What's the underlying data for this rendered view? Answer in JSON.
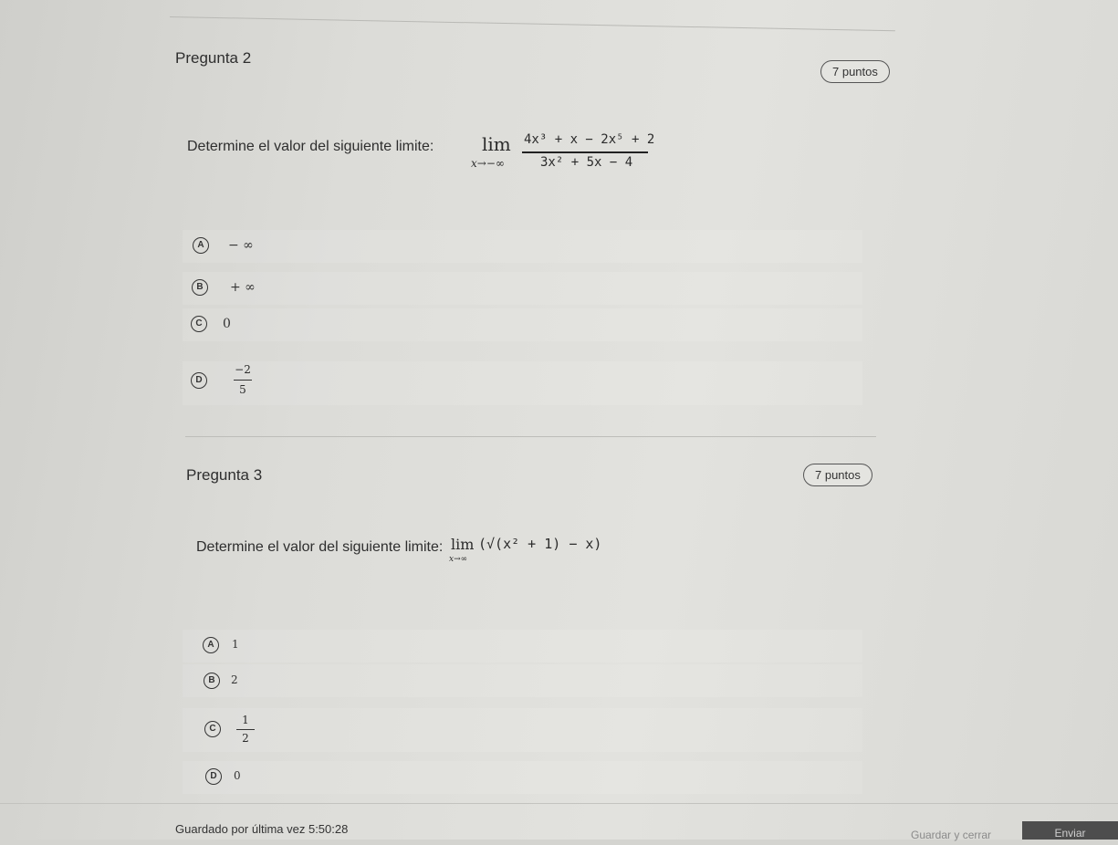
{
  "questions": [
    {
      "title": "Pregunta 2",
      "points": "7 puntos",
      "prompt": "Determine el valor del siguiente limite:",
      "limit": {
        "word": "lim",
        "sub": "x→−∞",
        "numerator": "4x³ + x − 2x⁵ + 2",
        "denominator": "3x² + 5x − 4"
      },
      "options": [
        {
          "letter": "A",
          "text": "− ∞"
        },
        {
          "letter": "B",
          "text": "+ ∞"
        },
        {
          "letter": "C",
          "text": "0"
        },
        {
          "letter": "D",
          "num": "−2",
          "den": "5"
        }
      ]
    },
    {
      "title": "Pregunta 3",
      "points": "7 puntos",
      "prompt": "Determine el valor del siguiente limite:",
      "limit": {
        "word": "lim",
        "sub": "x→∞",
        "expression": "(√(x² + 1) − x)"
      },
      "options": [
        {
          "letter": "A",
          "text": "1"
        },
        {
          "letter": "B",
          "text": "2"
        },
        {
          "letter": "C",
          "num": "1",
          "den": "2"
        },
        {
          "letter": "D",
          "text": "0"
        }
      ]
    }
  ],
  "footer": {
    "saved_text": "Guardado por última vez 5:50:28",
    "save_close_label": "Guardar y cerrar",
    "submit_label": "Enviar"
  }
}
